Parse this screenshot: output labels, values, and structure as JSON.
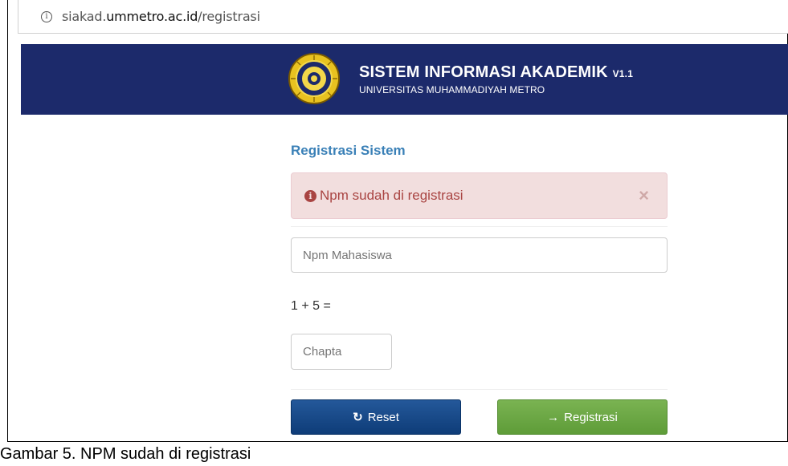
{
  "browser": {
    "url_prefix": "siakad.",
    "url_host": "ummetro.ac.id",
    "url_path": "/registrasi",
    "info_icon": "info-icon"
  },
  "header": {
    "title": "SISTEM INFORMASI AKADEMIK",
    "version": "V1.1",
    "subtitle": "UNIVERSITAS MUHAMMADIYAH METRO",
    "logo": "university-seal-logo",
    "background_color": "#1c2a6b"
  },
  "form": {
    "heading": "Registrasi Sistem",
    "alert": {
      "icon": "info-circle-icon",
      "message": "Npm sudah di registrasi",
      "close_symbol": "×",
      "color": "#a94442",
      "background": "#f2dede"
    },
    "npm_placeholder": "Npm Mahasiswa",
    "captcha_question": "1 + 5 =",
    "captcha_placeholder": "Chapta",
    "reset_label": "Reset",
    "reset_icon": "refresh-icon",
    "register_label": "Registrasi",
    "register_icon": "sign-in-icon",
    "reset_color": "#1b4a88",
    "register_color": "#6aa845"
  },
  "caption": "Gambar 5. NPM sudah di registrasi"
}
